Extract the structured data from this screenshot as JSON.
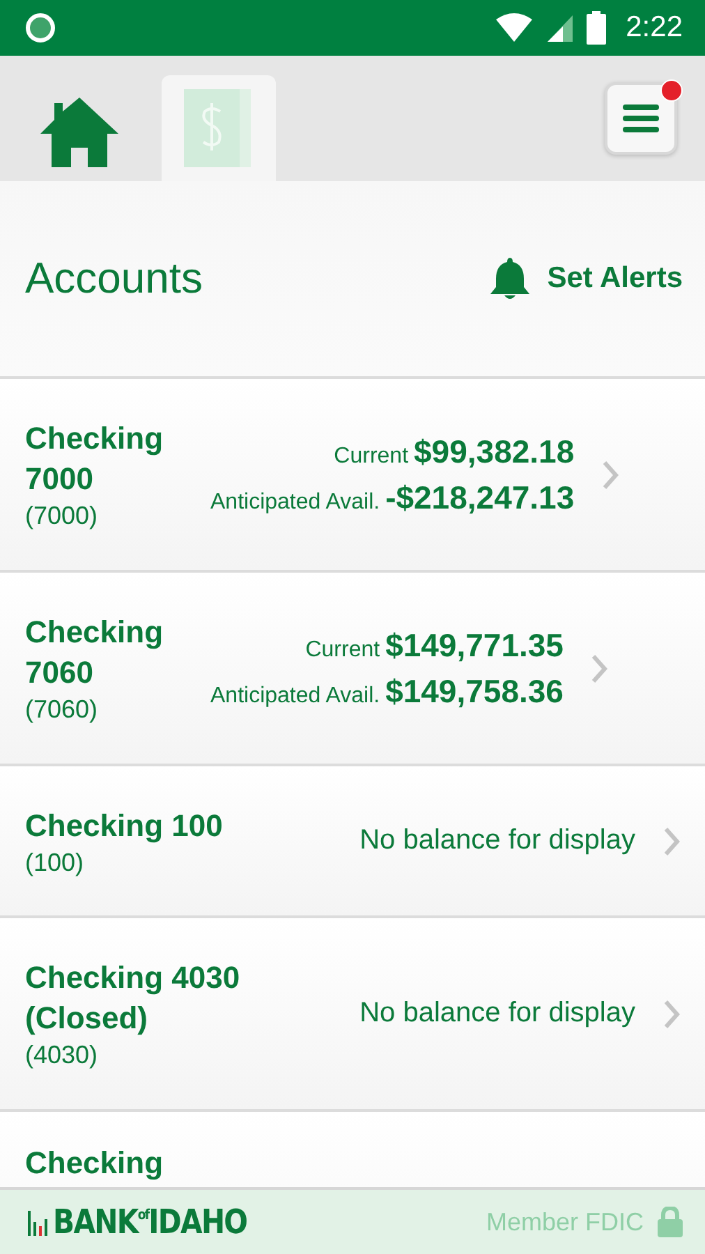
{
  "status_bar": {
    "time": "2:22"
  },
  "tabs": [
    {
      "kind": "home",
      "selected": false
    },
    {
      "kind": "accounts",
      "selected": true
    }
  ],
  "menu": {
    "notification": true
  },
  "header": {
    "title": "Accounts",
    "alerts_label": "Set Alerts"
  },
  "accounts": [
    {
      "kind": "balances",
      "name": "Checking 7000",
      "number": "(7000)",
      "current_label": "Current",
      "current": "$99,382.18",
      "anticipated_label": "Anticipated Avail.",
      "anticipated": "-$218,247.13"
    },
    {
      "kind": "balances",
      "name": "Checking 7060",
      "number": "(7060)",
      "current_label": "Current",
      "current": "$149,771.35",
      "anticipated_label": "Anticipated Avail.",
      "anticipated": "$149,758.36"
    },
    {
      "kind": "none",
      "name": "Checking 100",
      "number": "(100)",
      "message": "No balance for display"
    },
    {
      "kind": "none",
      "name": "Checking 4030 (Closed)",
      "number": "(4030)",
      "message": "No balance for display"
    },
    {
      "kind": "partial",
      "name": "Checking"
    }
  ],
  "footer": {
    "brand_main": "BANK",
    "brand_of": "of",
    "brand_end": "IDAHO",
    "member": "Member FDIC"
  }
}
